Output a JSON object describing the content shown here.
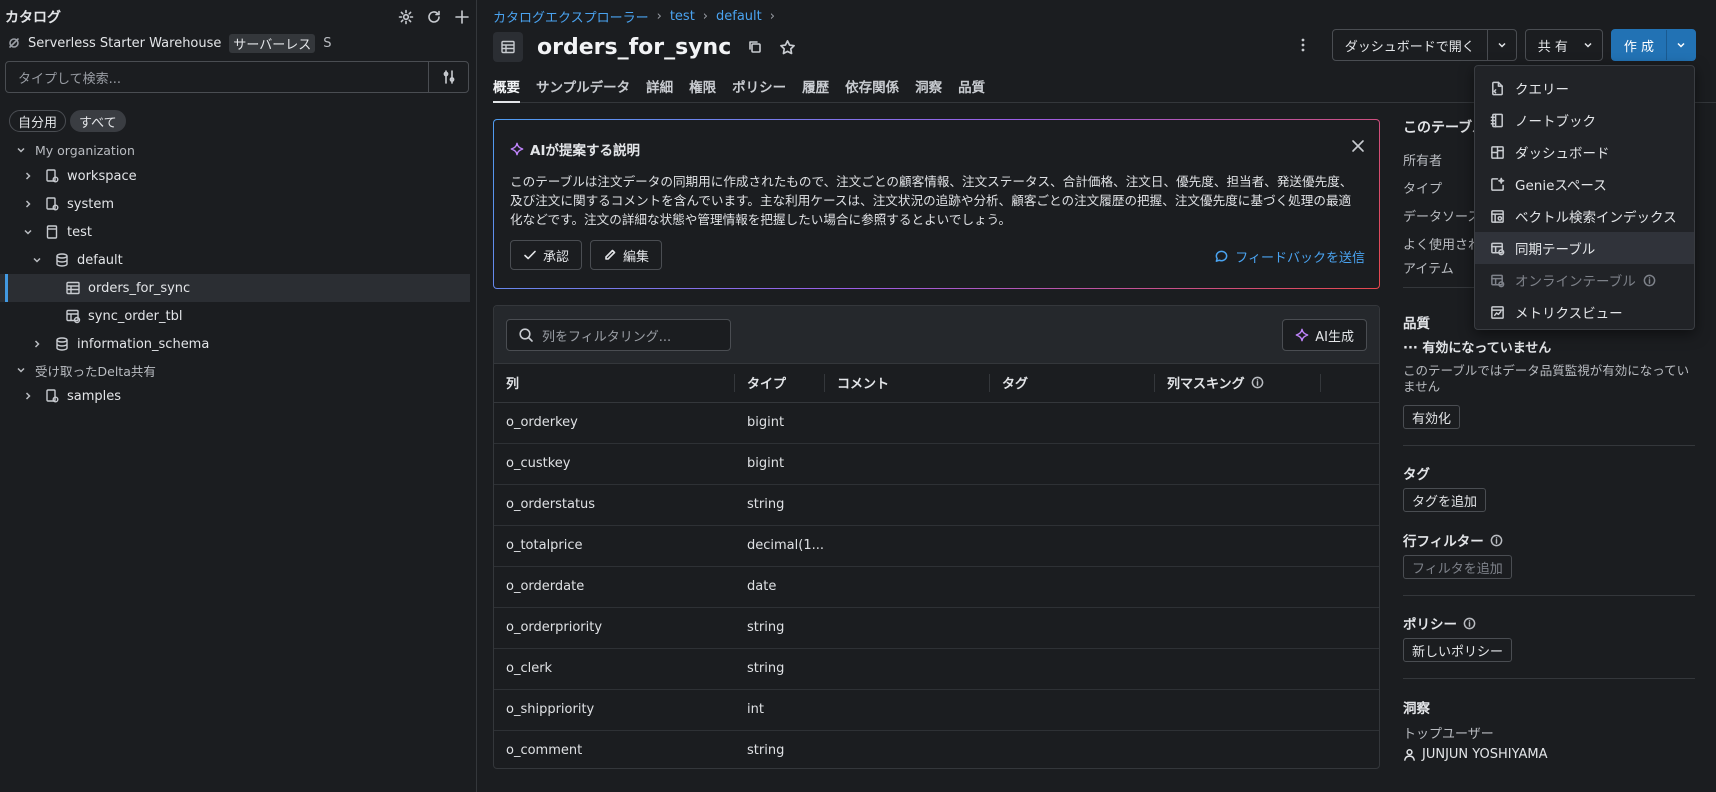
{
  "sidebar": {
    "title": "カタログ",
    "warehouse_name": "Serverless Starter Warehouse",
    "warehouse_badge": "サーバーレス",
    "warehouse_size": "S",
    "search_placeholder": "タイプして検索...",
    "pills": [
      "自分用",
      "すべて"
    ],
    "tree": [
      {
        "label": "My organization"
      },
      {
        "label": "workspace"
      },
      {
        "label": "system"
      },
      {
        "label": "test"
      },
      {
        "label": "default"
      },
      {
        "label": "orders_for_sync"
      },
      {
        "label": "sync_order_tbl"
      },
      {
        "label": "information_schema"
      },
      {
        "label": "受け取ったDelta共有"
      },
      {
        "label": "samples"
      }
    ]
  },
  "breadcrumb": [
    "カタログエクスプローラー",
    "test",
    "default"
  ],
  "page_title": "orders_for_sync",
  "actions": {
    "dashboard_label": "ダッシュボードで開く",
    "share_label": "共 有",
    "create_label": "作 成"
  },
  "tabs": [
    "概要",
    "サンプルデータ",
    "詳細",
    "権限",
    "ポリシー",
    "履歴",
    "依存関係",
    "洞察",
    "品質"
  ],
  "ai_card": {
    "title": "AIが提案する説明",
    "description": "このテーブルは注文データの同期用に作成されたもので、注文ごとの顧客情報、注文ステータス、合計価格、注文日、優先度、担当者、発送優先度、及び注文に関するコメントを含んでいます。主な利用ケースは、注文状況の追跡や分析、顧客ごとの注文履歴の把握、注文優先度に基づく処理の最適化などです。注文の詳細な状態や管理情報を把握したい場合に参照するとよいでしょう。",
    "approve_label": "承認",
    "edit_label": "編集",
    "feedback_label": "フィードバックを送信"
  },
  "columns_panel": {
    "filter_placeholder": "列をフィルタリング...",
    "ai_generate_label": "AI生成",
    "headers": [
      "列",
      "タイプ",
      "コメント",
      "タグ",
      "列マスキング"
    ],
    "rows": [
      {
        "name": "o_orderkey",
        "type": "bigint"
      },
      {
        "name": "o_custkey",
        "type": "bigint"
      },
      {
        "name": "o_orderstatus",
        "type": "string"
      },
      {
        "name": "o_totalprice",
        "type": "decimal(1..."
      },
      {
        "name": "o_orderdate",
        "type": "date"
      },
      {
        "name": "o_orderpriority",
        "type": "string"
      },
      {
        "name": "o_clerk",
        "type": "string"
      },
      {
        "name": "o_shippriority",
        "type": "int"
      },
      {
        "name": "o_comment",
        "type": "string"
      }
    ]
  },
  "info_panel": {
    "title": "このテーブル",
    "owner_label": "所有者",
    "type_label": "タイプ",
    "datasource_label": "データソース",
    "frequently_used_label": "よく使用され",
    "items_label": "アイテム",
    "quality_title": "品質",
    "quality_status": "··· 有効になっていません",
    "quality_desc": "このテーブルではデータ品質監視が有効になっていません",
    "enable_label": "有効化",
    "tags_title": "タグ",
    "add_tag_label": "タグを追加",
    "row_filter_title": "行フィルター",
    "add_filter_label": "フィルタを追加",
    "policy_title": "ポリシー",
    "new_policy_label": "新しいポリシー",
    "insights_title": "洞察",
    "top_users_label": "トップユーザー",
    "top_user": "JUNJUN YOSHIYAMA"
  },
  "create_menu": {
    "items": [
      {
        "label": "クエリー",
        "icon": "query-icon"
      },
      {
        "label": "ノートブック",
        "icon": "notebook-icon"
      },
      {
        "label": "ダッシュボード",
        "icon": "dashboard-icon"
      },
      {
        "label": "Genieスペース",
        "icon": "genie-icon"
      },
      {
        "label": "ベクトル検索インデックス",
        "icon": "vector-index-icon"
      },
      {
        "label": "同期テーブル",
        "icon": "synced-table-icon"
      },
      {
        "label": "オンラインテーブル",
        "icon": "online-table-icon"
      },
      {
        "label": "メトリクスビュー",
        "icon": "metric-view-icon"
      }
    ]
  },
  "colors": {
    "accent": "#2272b4",
    "link": "#4aa3f0",
    "background": "#1b1d20"
  }
}
